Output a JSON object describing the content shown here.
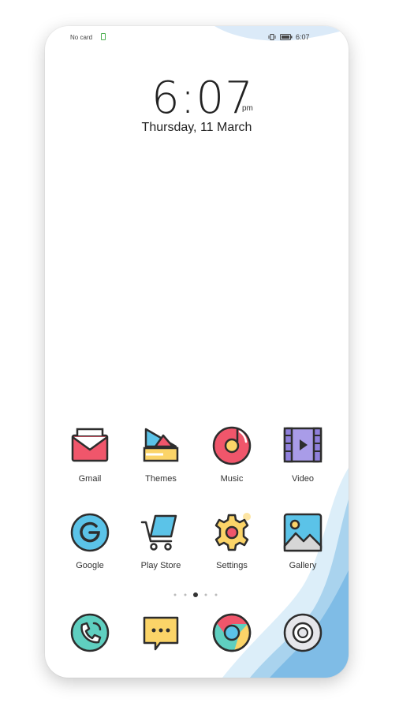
{
  "status_bar": {
    "carrier": "No card",
    "time": "6:07",
    "icons": [
      "sim-icon",
      "vibrate-icon",
      "battery-icon"
    ]
  },
  "lockscreen": {
    "clock": "6:07",
    "ampm": "pm",
    "date": "Thursday, 11 March"
  },
  "apps": [
    {
      "label": "Gmail",
      "icon": "gmail-icon"
    },
    {
      "label": "Themes",
      "icon": "themes-icon"
    },
    {
      "label": "Music",
      "icon": "music-icon"
    },
    {
      "label": "Video",
      "icon": "video-icon"
    },
    {
      "label": "Google",
      "icon": "google-icon"
    },
    {
      "label": "Play Store",
      "icon": "play-store-icon"
    },
    {
      "label": "Settings",
      "icon": "settings-icon"
    },
    {
      "label": "Gallery",
      "icon": "gallery-icon"
    }
  ],
  "page_indicator": {
    "pages": 5,
    "active": 3
  },
  "dock": [
    {
      "icon": "phone-icon"
    },
    {
      "icon": "messages-icon"
    },
    {
      "icon": "chrome-icon"
    },
    {
      "icon": "camera-icon"
    }
  ],
  "colors": {
    "icon_outline": "#2d2d2d",
    "red": "#f0566b",
    "yellow": "#fbd468",
    "blue": "#5bc3e8",
    "purple": "#a99ce8",
    "teal": "#5fcfc0",
    "wave_light": "#cfe6f6",
    "wave_mid": "#9fcde9"
  }
}
